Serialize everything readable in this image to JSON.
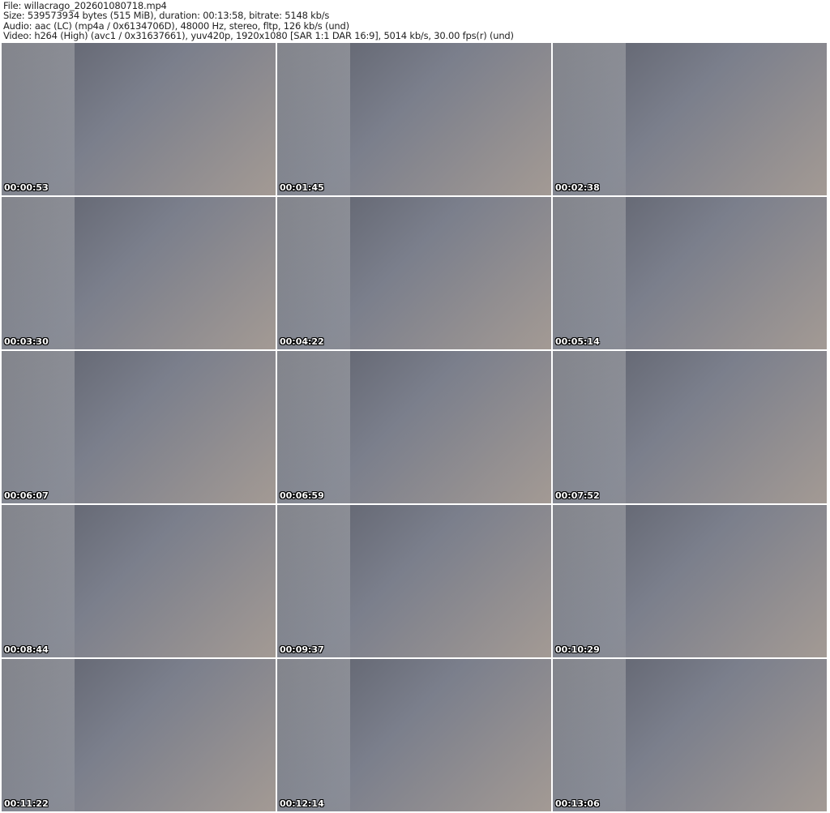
{
  "header": {
    "file": "File: willacrago_202601080718.mp4",
    "size": "Size: 539573934 bytes (515 MiB), duration: 00:13:58, bitrate: 5148 kb/s",
    "audio": "Audio: aac (LC) (mp4a / 0x6134706D), 48000 Hz, stereo, fltp, 126 kb/s (und)",
    "video": "Video: h264 (High) (avc1 / 0x31637661), yuv420p, 1920x1080 [SAR 1:1 DAR 16:9], 5014 kb/s, 30.00 fps(r) (und)"
  },
  "thumbnails": [
    {
      "timestamp": "00:00:53"
    },
    {
      "timestamp": "00:01:45"
    },
    {
      "timestamp": "00:02:38"
    },
    {
      "timestamp": "00:03:30"
    },
    {
      "timestamp": "00:04:22"
    },
    {
      "timestamp": "00:05:14"
    },
    {
      "timestamp": "00:06:07"
    },
    {
      "timestamp": "00:06:59"
    },
    {
      "timestamp": "00:07:52"
    },
    {
      "timestamp": "00:08:44"
    },
    {
      "timestamp": "00:09:37"
    },
    {
      "timestamp": "00:10:29"
    },
    {
      "timestamp": "00:11:22"
    },
    {
      "timestamp": "00:12:14"
    },
    {
      "timestamp": "00:13:06"
    }
  ]
}
